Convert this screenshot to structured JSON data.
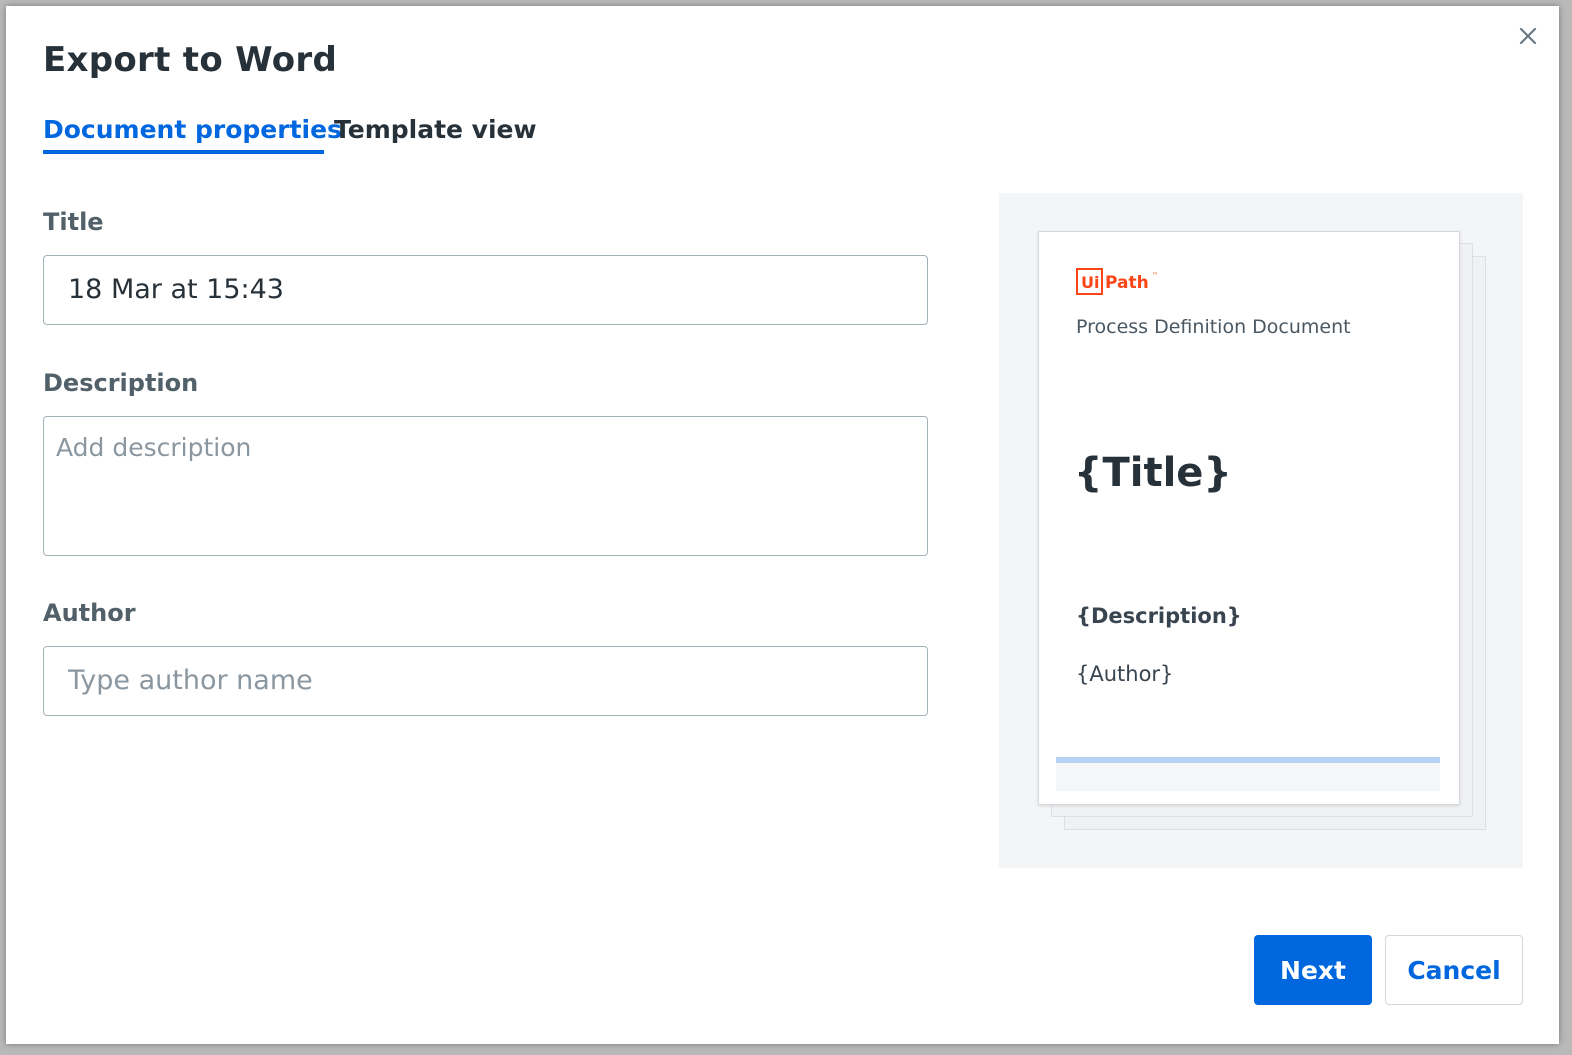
{
  "dialog": {
    "title": "Export to Word",
    "close_icon": "close-icon"
  },
  "tabs": [
    {
      "label": "Document properties",
      "active": true
    },
    {
      "label": "Template view",
      "active": false
    }
  ],
  "form": {
    "title_label": "Title",
    "title_value": "18 Mar at 15:43",
    "description_label": "Description",
    "description_placeholder": "Add description",
    "description_value": "",
    "author_label": "Author",
    "author_placeholder": "Type author name",
    "author_value": ""
  },
  "preview": {
    "logo_text": "UiPath",
    "doc_type": "Process Definition Document",
    "title_placeholder": "{Title}",
    "description_placeholder": "{Description}",
    "author_placeholder": "{Author}"
  },
  "footer": {
    "next_label": "Next",
    "cancel_label": "Cancel"
  },
  "colors": {
    "accent": "#0067df",
    "brand": "#fa4616",
    "text_primary": "#273139",
    "label": "#526069"
  }
}
